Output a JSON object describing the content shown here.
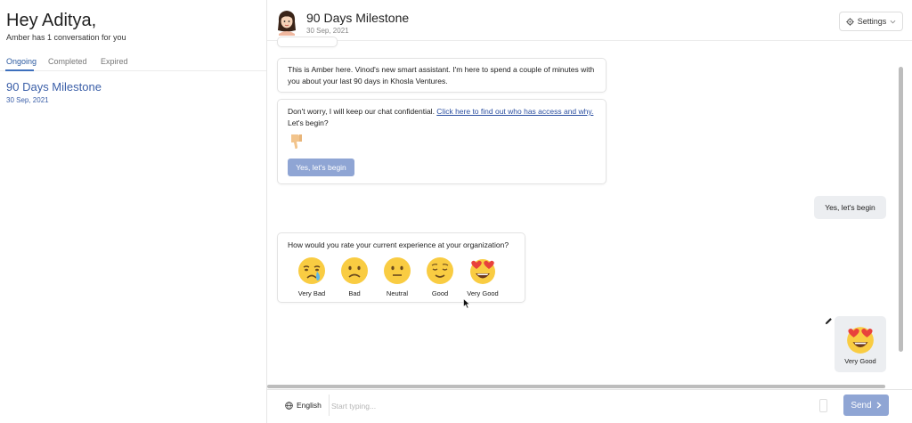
{
  "sidebar": {
    "greeting": "Hey Aditya,",
    "subtitle": "Amber has 1 conversation for you",
    "tabs": [
      {
        "label": "Ongoing",
        "active": true
      },
      {
        "label": "Completed",
        "active": false
      },
      {
        "label": "Expired",
        "active": false
      }
    ],
    "conversations": [
      {
        "title": "90 Days Milestone",
        "date": "30 Sep, 2021"
      }
    ]
  },
  "header": {
    "title": "90 Days Milestone",
    "date": "30 Sep, 2021",
    "settings_label": "Settings",
    "avatar_icon": "woman-avatar-icon"
  },
  "chat": {
    "messages": {
      "intro": "This is Amber here. Vinod's new smart assistant. I'm here to spend a couple of minutes with you about your last 90 days in Khosla Ventures.",
      "confidential_prefix": "Don't worry, I will keep our chat confidential. ",
      "confidential_link": "Click here to find out who has access and why.",
      "confidential_suffix": " Let's begin?",
      "begin_button": "Yes, let's begin",
      "user_reply_1": "Yes, let's begin",
      "rating_question": "How would you rate your current experience at your organization?",
      "rating_options": [
        {
          "label": "Very Bad",
          "icon": "crying-face-icon"
        },
        {
          "label": "Bad",
          "icon": "frowning-face-icon"
        },
        {
          "label": "Neutral",
          "icon": "neutral-face-icon"
        },
        {
          "label": "Good",
          "icon": "relieved-face-icon"
        },
        {
          "label": "Very Good",
          "icon": "heart-eyes-face-icon"
        }
      ],
      "user_reply_2": "Very Good"
    }
  },
  "input": {
    "language": "English",
    "placeholder": "Start typing...",
    "send_label": "Send"
  },
  "colors": {
    "accent": "#3b5fa8",
    "button": "#8fa5d4",
    "user_bubble": "#eceef1",
    "emoji_yellow": "#f9cc42"
  }
}
